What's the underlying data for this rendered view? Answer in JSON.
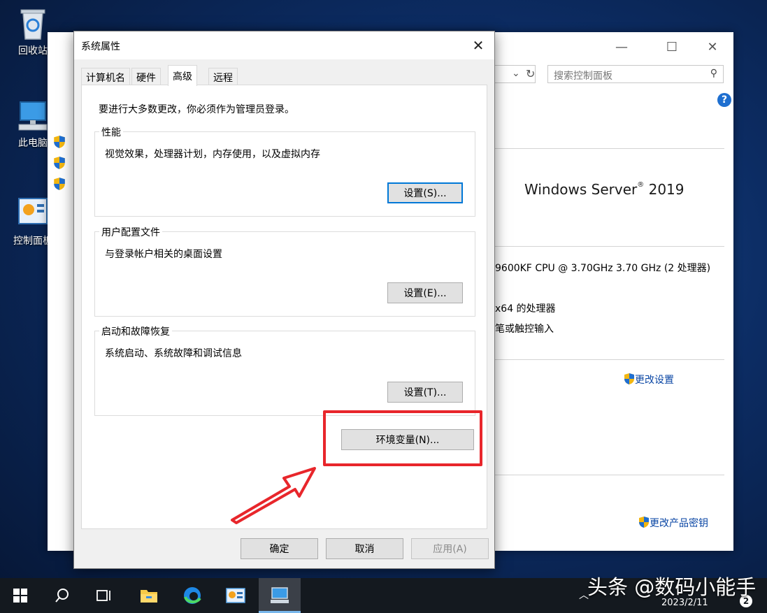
{
  "desktop": {
    "icons": [
      {
        "label": "回收站"
      },
      {
        "label": "此电脑"
      },
      {
        "label": "控制面板"
      }
    ]
  },
  "control_panel": {
    "search_placeholder": "搜索控制面板",
    "os_name": "Windows Server",
    "os_version": "2019",
    "cpu": "9600KF CPU @ 3.70GHz   3.70 GHz  (2 处理器)",
    "system_type": "x64 的处理器",
    "pen_touch": "笔或触控输入",
    "change_settings": "更改设置",
    "change_product_key": "更改产品密钥"
  },
  "dialog": {
    "title": "系统属性",
    "tabs": [
      "计算机名",
      "硬件",
      "高级",
      "远程"
    ],
    "active_tab": "高级",
    "admin_note": "要进行大多数更改，你必须作为管理员登录。",
    "performance": {
      "title": "性能",
      "desc": "视觉效果，处理器计划，内存使用，以及虚拟内存",
      "button": "设置(S)..."
    },
    "user_profiles": {
      "title": "用户配置文件",
      "desc": "与登录帐户相关的桌面设置",
      "button": "设置(E)..."
    },
    "startup_recovery": {
      "title": "启动和故障恢复",
      "desc": "系统启动、系统故障和调试信息",
      "button": "设置(T)..."
    },
    "env_button": "环境变量(N)...",
    "ok": "确定",
    "cancel": "取消",
    "apply": "应用(A)"
  },
  "taskbar": {
    "watermark": "头条 @数码小能手",
    "date": "2023/2/11",
    "badge": "2"
  },
  "colors": {
    "highlight_red": "#e8262b",
    "focus_blue": "#0078d7",
    "link_blue": "#0a46a4"
  }
}
